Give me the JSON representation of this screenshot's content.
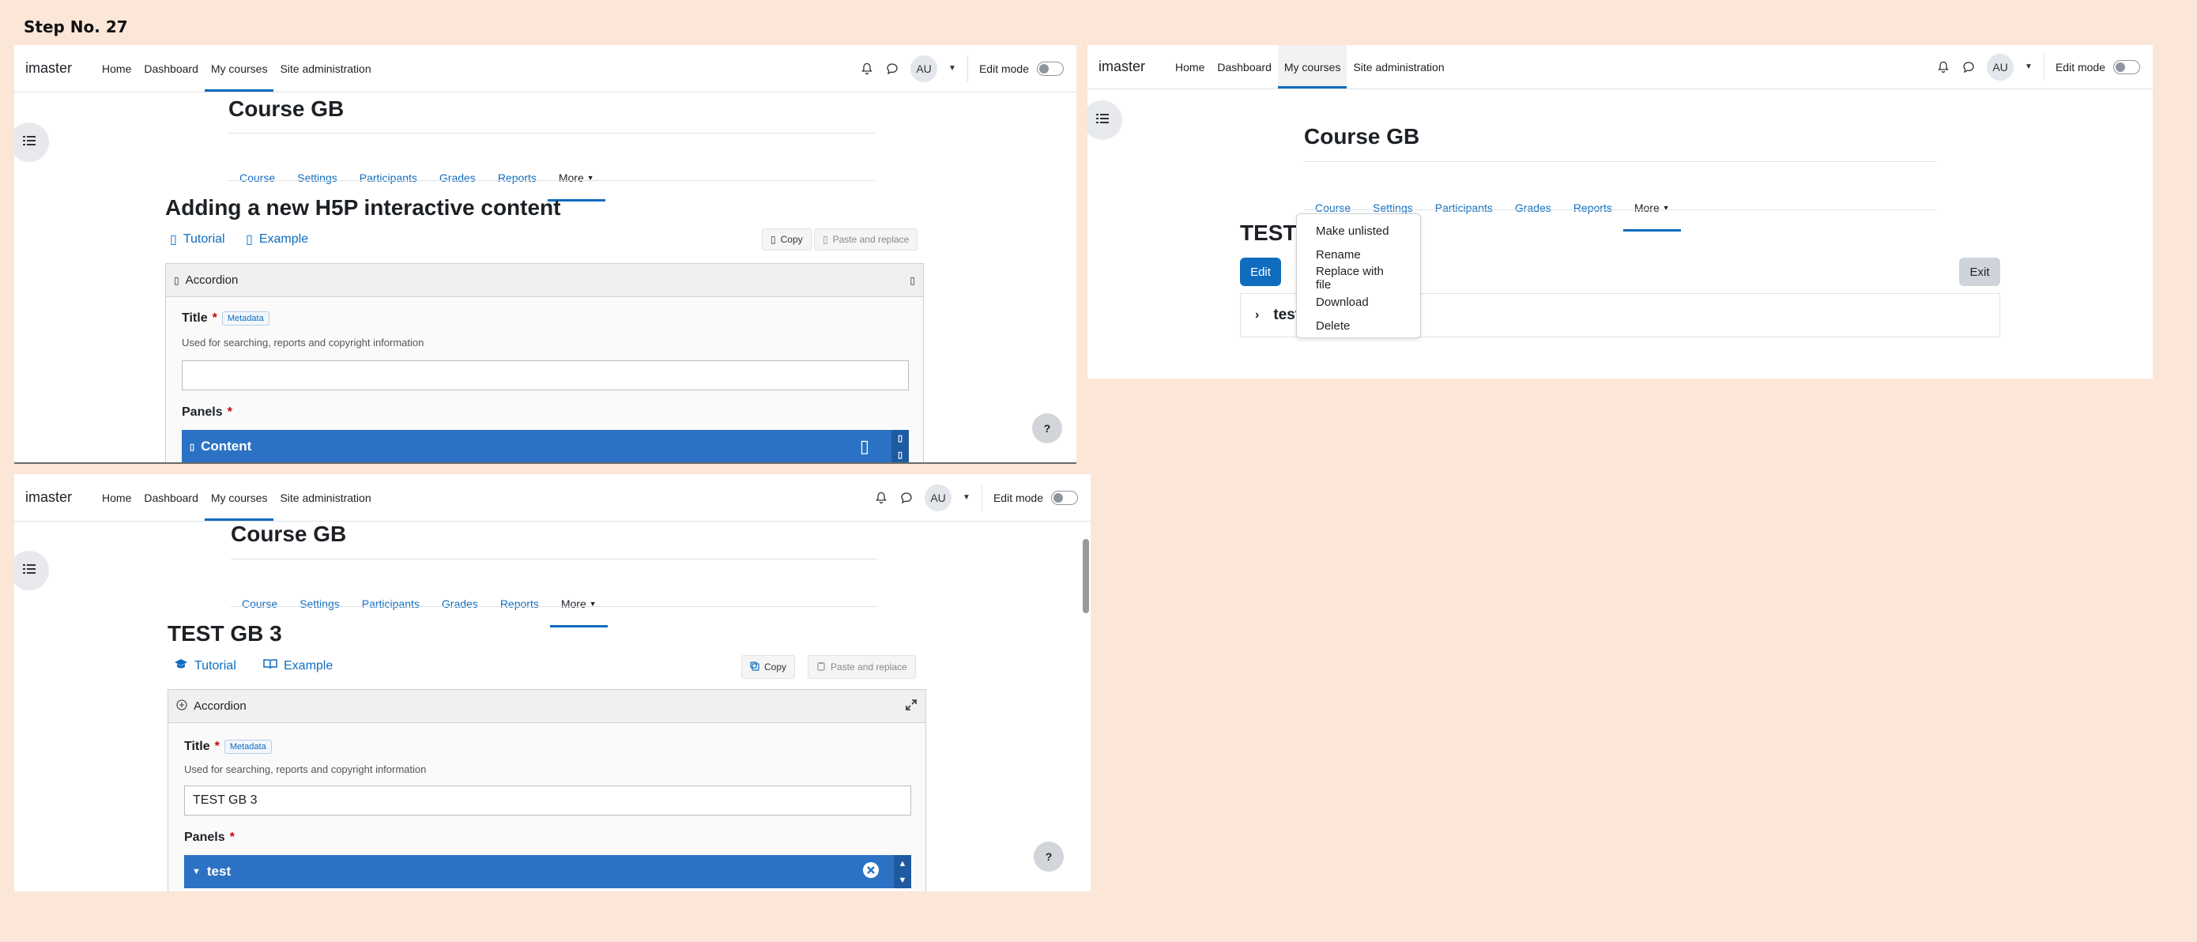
{
  "step_label": "Step No. 27",
  "common": {
    "brand": "imaster",
    "nav": [
      "Home",
      "Dashboard",
      "My courses",
      "Site administration"
    ],
    "avatar": "AU",
    "edit_mode": "Edit mode",
    "course_title": "Course GB",
    "secondary_nav": [
      "Course",
      "Settings",
      "Participants",
      "Grades",
      "Reports",
      "More"
    ]
  },
  "panel1": {
    "heading": "Adding a new H5P interactive content",
    "tutorial": "Tutorial",
    "example": "Example",
    "copy": "Copy",
    "paste": "Paste and replace",
    "library": "Accordion",
    "title_label": "Title",
    "metadata": "Metadata",
    "title_desc": "Used for searching, reports and copyright information",
    "title_value": "",
    "panels_label": "Panels",
    "panel_item": "Content",
    "help": "?"
  },
  "panel2": {
    "heading": "TEST",
    "edit_button": "Edit",
    "exit_button": "Exit",
    "accordion_item": "test",
    "dropdown": [
      "Make unlisted",
      "Rename",
      "Replace with file",
      "Download",
      "Delete"
    ]
  },
  "panel3": {
    "heading": "TEST GB 3",
    "tutorial": "Tutorial",
    "example": "Example",
    "copy": "Copy",
    "paste": "Paste and replace",
    "library": "Accordion",
    "title_label": "Title",
    "metadata": "Metadata",
    "title_desc": "Used for searching, reports and copyright information",
    "title_value": "TEST GB 3",
    "panels_label": "Panels",
    "panel_item": "test",
    "help": "?"
  },
  "colors": {
    "accent": "#0f6cbf",
    "background": "#fbe6d8",
    "panel_bar": "#2c72c4"
  }
}
